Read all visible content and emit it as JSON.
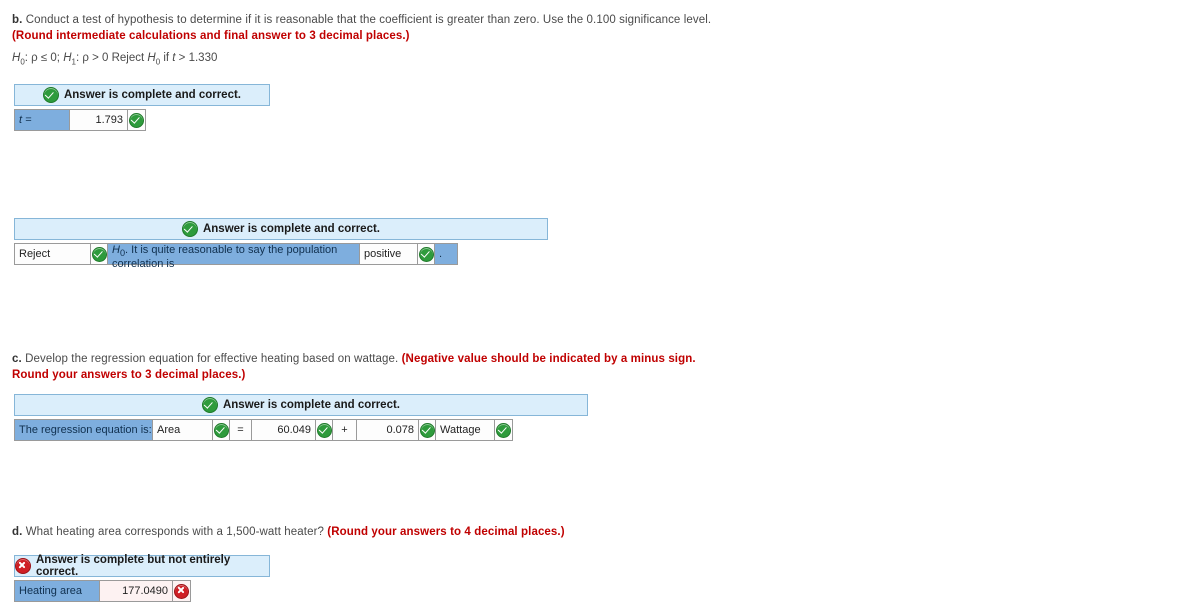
{
  "page": {
    "status_ok_label": "Answer is complete and correct.",
    "status_bad_label": "Answer is complete but not entirely correct."
  },
  "part_b": {
    "lead": "b.",
    "question": " Conduct a test of hypothesis to determine if it is reasonable that the coefficient is greater than zero. Use the 0.100 significance level. ",
    "instruction": "(Round intermediate calculations and final answer to 3 decimal places.)",
    "hypothesis": "H0: ρ ≤ 0; H1: ρ > 0 Reject H0 if t > 1.330",
    "hypothesis_parts": {
      "h0": "H",
      "h0_sub": "0",
      "h0_rest": ": ρ ≤ 0; ",
      "h1": "H",
      "h1_sub": "1",
      "h1_rest": ": ρ > 0 Reject ",
      "h0b": "H",
      "h0b_sub": "0",
      "tail_if": " if ",
      "t_var": "t",
      "tail_value": " > 1.330"
    },
    "answer": {
      "status": "Answer is complete and correct.",
      "status_icon": "check-circle-green-icon",
      "field_label": "t =",
      "field_value": "1.793",
      "value_icon": "check-circle-green-icon"
    }
  },
  "part_b_conclusion": {
    "status": "Answer is complete and correct.",
    "status_icon": "check-circle-green-icon",
    "decision_value": "Reject",
    "decision_icon": "check-circle-green-icon",
    "statement_h": "H",
    "statement_h_sub": "0",
    "statement_text": ". It is quite reasonable to say the population correlation is",
    "direction_value": "positive",
    "direction_icon": "check-circle-green-icon",
    "period": "."
  },
  "part_c": {
    "lead": "c.",
    "question": " Develop the regression equation for effective heating based on wattage. ",
    "instruction": "(Negative value should be indicated by a minus sign. Round your answers to 3 decimal places.)",
    "answer": {
      "status": "Answer is complete and correct.",
      "status_icon": "check-circle-green-icon",
      "row_label": "The regression equation is:",
      "dependent": "Area",
      "dependent_icon": "check-circle-green-icon",
      "equals": "=",
      "intercept": "60.049",
      "intercept_icon": "check-circle-green-icon",
      "operator": "+",
      "slope": "0.078",
      "slope_icon": "check-circle-green-icon",
      "independent": "Wattage",
      "independent_icon": "check-circle-green-icon"
    }
  },
  "part_d": {
    "lead": "d.",
    "question": " What heating area corresponds with a 1,500-watt heater? ",
    "instruction": "(Round your answers to 4 decimal places.)",
    "answer": {
      "status": "Answer is complete but not entirely correct.",
      "status_icon": "x-circle-red-icon",
      "field_label": "Heating area",
      "field_value": "177.0490",
      "value_icon": "x-circle-red-icon"
    }
  },
  "colors": {
    "banner_bg": "#dbeefb",
    "banner_border": "#86b6d8",
    "label_bg": "#7eaede",
    "ok_green": "#2e9b3c",
    "bad_red": "#cf1f25",
    "red_text": "#c00000",
    "wrong_input_bg": "#fdf2f2"
  }
}
